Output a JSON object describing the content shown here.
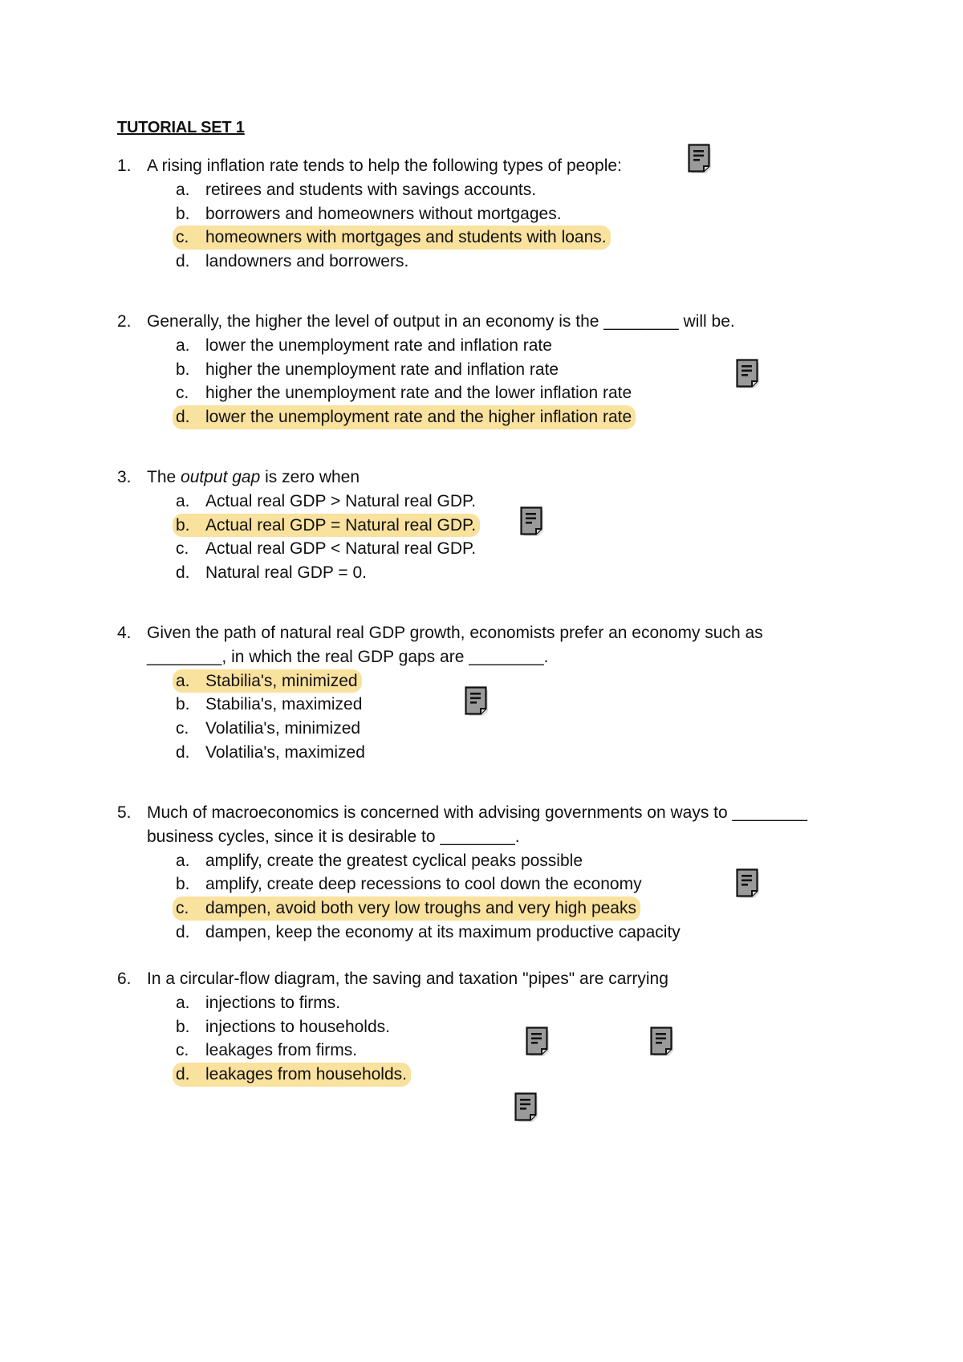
{
  "document": {
    "title": "TUTORIAL SET 1",
    "highlight_color": "#f9e19e",
    "questions": [
      {
        "number": "1.",
        "lines": [
          "A rising inflation rate tends to help the following types of people:"
        ],
        "options": [
          {
            "letter": "a.",
            "text": "retirees and students with savings accounts.",
            "highlighted": false
          },
          {
            "letter": "b.",
            "text": "borrowers and homeowners without mortgages.",
            "highlighted": false
          },
          {
            "letter": "c.",
            "text": "homeowners with mortgages and students with loans.",
            "highlighted": true
          },
          {
            "letter": "d.",
            "text": "landowners and borrowers.",
            "highlighted": false
          }
        ]
      },
      {
        "number": "2.",
        "lines": [
          "Generally, the higher the level of output in an economy is the ________ will be."
        ],
        "options": [
          {
            "letter": "a.",
            "text": "lower the unemployment rate and inflation rate",
            "highlighted": false
          },
          {
            "letter": "b.",
            "text": "higher the unemployment rate and inflation rate",
            "highlighted": false
          },
          {
            "letter": "c.",
            "text": "higher the unemployment rate and the lower inflation rate",
            "highlighted": false
          },
          {
            "letter": "d.",
            "text": "lower the unemployment rate and the higher inflation rate",
            "highlighted": true
          }
        ]
      },
      {
        "number": "3.",
        "text_before": "The ",
        "text_italic": "output gap",
        "text_after": " is zero when",
        "options": [
          {
            "letter": "a.",
            "text": "Actual real GDP > Natural real GDP.",
            "highlighted": false
          },
          {
            "letter": "b.",
            "text": "Actual real GDP = Natural real GDP.",
            "highlighted": true
          },
          {
            "letter": "c.",
            "text": "Actual real GDP < Natural real GDP.",
            "highlighted": false
          },
          {
            "letter": "d.",
            "text": "Natural real GDP = 0.",
            "highlighted": false
          }
        ]
      },
      {
        "number": "4.",
        "lines": [
          "Given the path of natural real GDP growth, economists prefer an economy such as",
          "________, in which the real GDP gaps are ________."
        ],
        "options": [
          {
            "letter": "a.",
            "text": "Stabilia's, minimized",
            "highlighted": true
          },
          {
            "letter": "b.",
            "text": "Stabilia's, maximized",
            "highlighted": false
          },
          {
            "letter": "c.",
            "text": "Volatilia's, minimized",
            "highlighted": false
          },
          {
            "letter": "d.",
            "text": "Volatilia's, maximized",
            "highlighted": false
          }
        ]
      },
      {
        "number": "5.",
        "lines": [
          "Much of macroeconomics is concerned with advising governments on ways to ________",
          "business cycles, since it is desirable to ________."
        ],
        "options": [
          {
            "letter": "a.",
            "text": "amplify, create the greatest cyclical peaks possible",
            "highlighted": false
          },
          {
            "letter": "b.",
            "text": "amplify, create deep recessions to cool down the economy",
            "highlighted": false
          },
          {
            "letter": "c.",
            "text": "dampen, avoid both very low troughs and very high peaks",
            "highlighted": true
          },
          {
            "letter": "d.",
            "text": "dampen, keep the economy at its maximum productive capacity",
            "highlighted": false
          }
        ]
      },
      {
        "number": "6.",
        "lines": [
          "In a circular-flow diagram, the saving and taxation \"pipes\" are carrying"
        ],
        "options": [
          {
            "letter": "a.",
            "text": "injections to firms.",
            "highlighted": false
          },
          {
            "letter": "b.",
            "text": "injections to households.",
            "highlighted": false
          },
          {
            "letter": "c.",
            "text": "leakages from firms.",
            "highlighted": false
          },
          {
            "letter": "d.",
            "text": "leakages from households.",
            "highlighted": true
          }
        ]
      }
    ],
    "annotation_icons": [
      {
        "icon": "comment-note-icon"
      },
      {
        "icon": "comment-note-icon"
      },
      {
        "icon": "comment-note-icon"
      },
      {
        "icon": "comment-note-icon"
      },
      {
        "icon": "comment-note-icon"
      },
      {
        "icon": "comment-note-icon"
      },
      {
        "icon": "comment-note-icon"
      },
      {
        "icon": "comment-note-icon"
      }
    ]
  }
}
